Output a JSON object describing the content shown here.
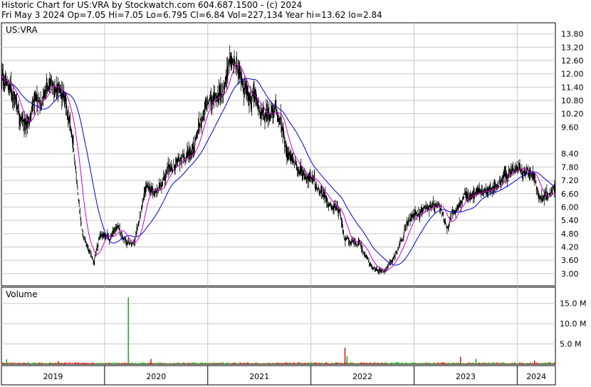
{
  "header": {
    "line1": "Historic Chart for US:VRA by Stockwatch.com 604.687.1500 - (c) 2024",
    "line2": "Fri May  3 2024  Op=7.05  Hi=7.05  Lo=6.795  Cl=6.84  Vol=227,134  Year hi=13.62  lo=2.84"
  },
  "colors": {
    "price": "#000000",
    "ma_short": "#cc00cc",
    "ma_long": "#0000cc",
    "vol_up": "#00aa00",
    "vol_down": "#dd0000",
    "grid": "#c8c8c8"
  },
  "chart_data": {
    "type": "line",
    "symbol_label": "US:VRA",
    "volume_label": "Volume",
    "price_ticks": [
      3.0,
      3.6,
      4.2,
      4.8,
      5.4,
      6.0,
      6.6,
      7.2,
      7.8,
      8.4,
      9.6,
      10.2,
      10.8,
      11.4,
      12.0,
      12.6,
      13.2,
      13.8
    ],
    "price_tick_labels": [
      "3.00",
      "3.60",
      "4.20",
      "4.80",
      "5.40",
      "6.00",
      "6.60",
      "7.20",
      "7.80",
      "8.40",
      "9.60",
      "10.20",
      "10.80",
      "11.40",
      "12.00",
      "12.60",
      "13.20",
      "13.80"
    ],
    "price_ylim": [
      2.45,
      14.3
    ],
    "volume_ticks": [
      5,
      10,
      15
    ],
    "volume_tick_labels": [
      "5.0 M",
      "10.0 M",
      "15.0 M"
    ],
    "volume_ylim": [
      0,
      19
    ],
    "x_range": [
      2019.0,
      2024.37
    ],
    "years": [
      "2019",
      "2020",
      "2021",
      "2022",
      "2023",
      "2024"
    ],
    "year_starts": [
      2019.0,
      2020.0,
      2021.0,
      2022.0,
      2023.0,
      2024.0
    ],
    "price_keypoints": [
      [
        2019.0,
        11.8
      ],
      [
        2019.1,
        11.3
      ],
      [
        2019.18,
        10.3
      ],
      [
        2019.24,
        9.6
      ],
      [
        2019.3,
        10.4
      ],
      [
        2019.4,
        11.0
      ],
      [
        2019.5,
        11.5
      ],
      [
        2019.58,
        11.1
      ],
      [
        2019.65,
        10.0
      ],
      [
        2019.72,
        7.8
      ],
      [
        2019.78,
        5.0
      ],
      [
        2019.84,
        4.1
      ],
      [
        2019.9,
        3.6
      ],
      [
        2019.96,
        4.8
      ],
      [
        2020.05,
        4.6
      ],
      [
        2020.12,
        5.1
      ],
      [
        2020.22,
        4.3
      ],
      [
        2020.3,
        4.5
      ],
      [
        2020.4,
        6.8
      ],
      [
        2020.5,
        6.6
      ],
      [
        2020.6,
        7.6
      ],
      [
        2020.75,
        8.1
      ],
      [
        2020.85,
        8.6
      ],
      [
        2020.95,
        10.2
      ],
      [
        2021.05,
        10.9
      ],
      [
        2021.15,
        11.3
      ],
      [
        2021.2,
        12.6
      ],
      [
        2021.26,
        12.3
      ],
      [
        2021.32,
        11.6
      ],
      [
        2021.4,
        11.3
      ],
      [
        2021.48,
        10.4
      ],
      [
        2021.55,
        9.9
      ],
      [
        2021.62,
        10.4
      ],
      [
        2021.7,
        9.9
      ],
      [
        2021.76,
        8.5
      ],
      [
        2021.85,
        8.0
      ],
      [
        2021.93,
        7.5
      ],
      [
        2022.0,
        7.3
      ],
      [
        2022.1,
        6.8
      ],
      [
        2022.18,
        6.2
      ],
      [
        2022.28,
        5.9
      ],
      [
        2022.33,
        4.6
      ],
      [
        2022.4,
        4.4
      ],
      [
        2022.48,
        4.3
      ],
      [
        2022.55,
        3.6
      ],
      [
        2022.62,
        3.1
      ],
      [
        2022.72,
        3.2
      ],
      [
        2022.8,
        3.7
      ],
      [
        2022.88,
        4.6
      ],
      [
        2022.95,
        5.4
      ],
      [
        2023.05,
        5.8
      ],
      [
        2023.15,
        6.1
      ],
      [
        2023.25,
        5.8
      ],
      [
        2023.32,
        5.1
      ],
      [
        2023.38,
        5.8
      ],
      [
        2023.48,
        6.4
      ],
      [
        2023.58,
        6.6
      ],
      [
        2023.7,
        6.8
      ],
      [
        2023.8,
        7.0
      ],
      [
        2023.9,
        7.4
      ],
      [
        2024.0,
        7.7
      ],
      [
        2024.08,
        7.5
      ],
      [
        2024.16,
        7.6
      ],
      [
        2024.22,
        6.3
      ],
      [
        2024.28,
        6.5
      ],
      [
        2024.37,
        6.84
      ]
    ],
    "volume_spikes": [
      {
        "x": 2019.05,
        "v": 1.2,
        "up": true
      },
      {
        "x": 2019.55,
        "v": 0.8,
        "up": false
      },
      {
        "x": 2020.23,
        "v": 16.5,
        "up": true
      },
      {
        "x": 2020.45,
        "v": 1.3,
        "up": false
      },
      {
        "x": 2022.33,
        "v": 4.1,
        "up": false
      },
      {
        "x": 2022.35,
        "v": 2.0,
        "up": true
      },
      {
        "x": 2023.45,
        "v": 1.8,
        "up": false
      },
      {
        "x": 2023.6,
        "v": 1.3,
        "up": true
      },
      {
        "x": 2024.17,
        "v": 0.9,
        "up": false
      }
    ]
  }
}
